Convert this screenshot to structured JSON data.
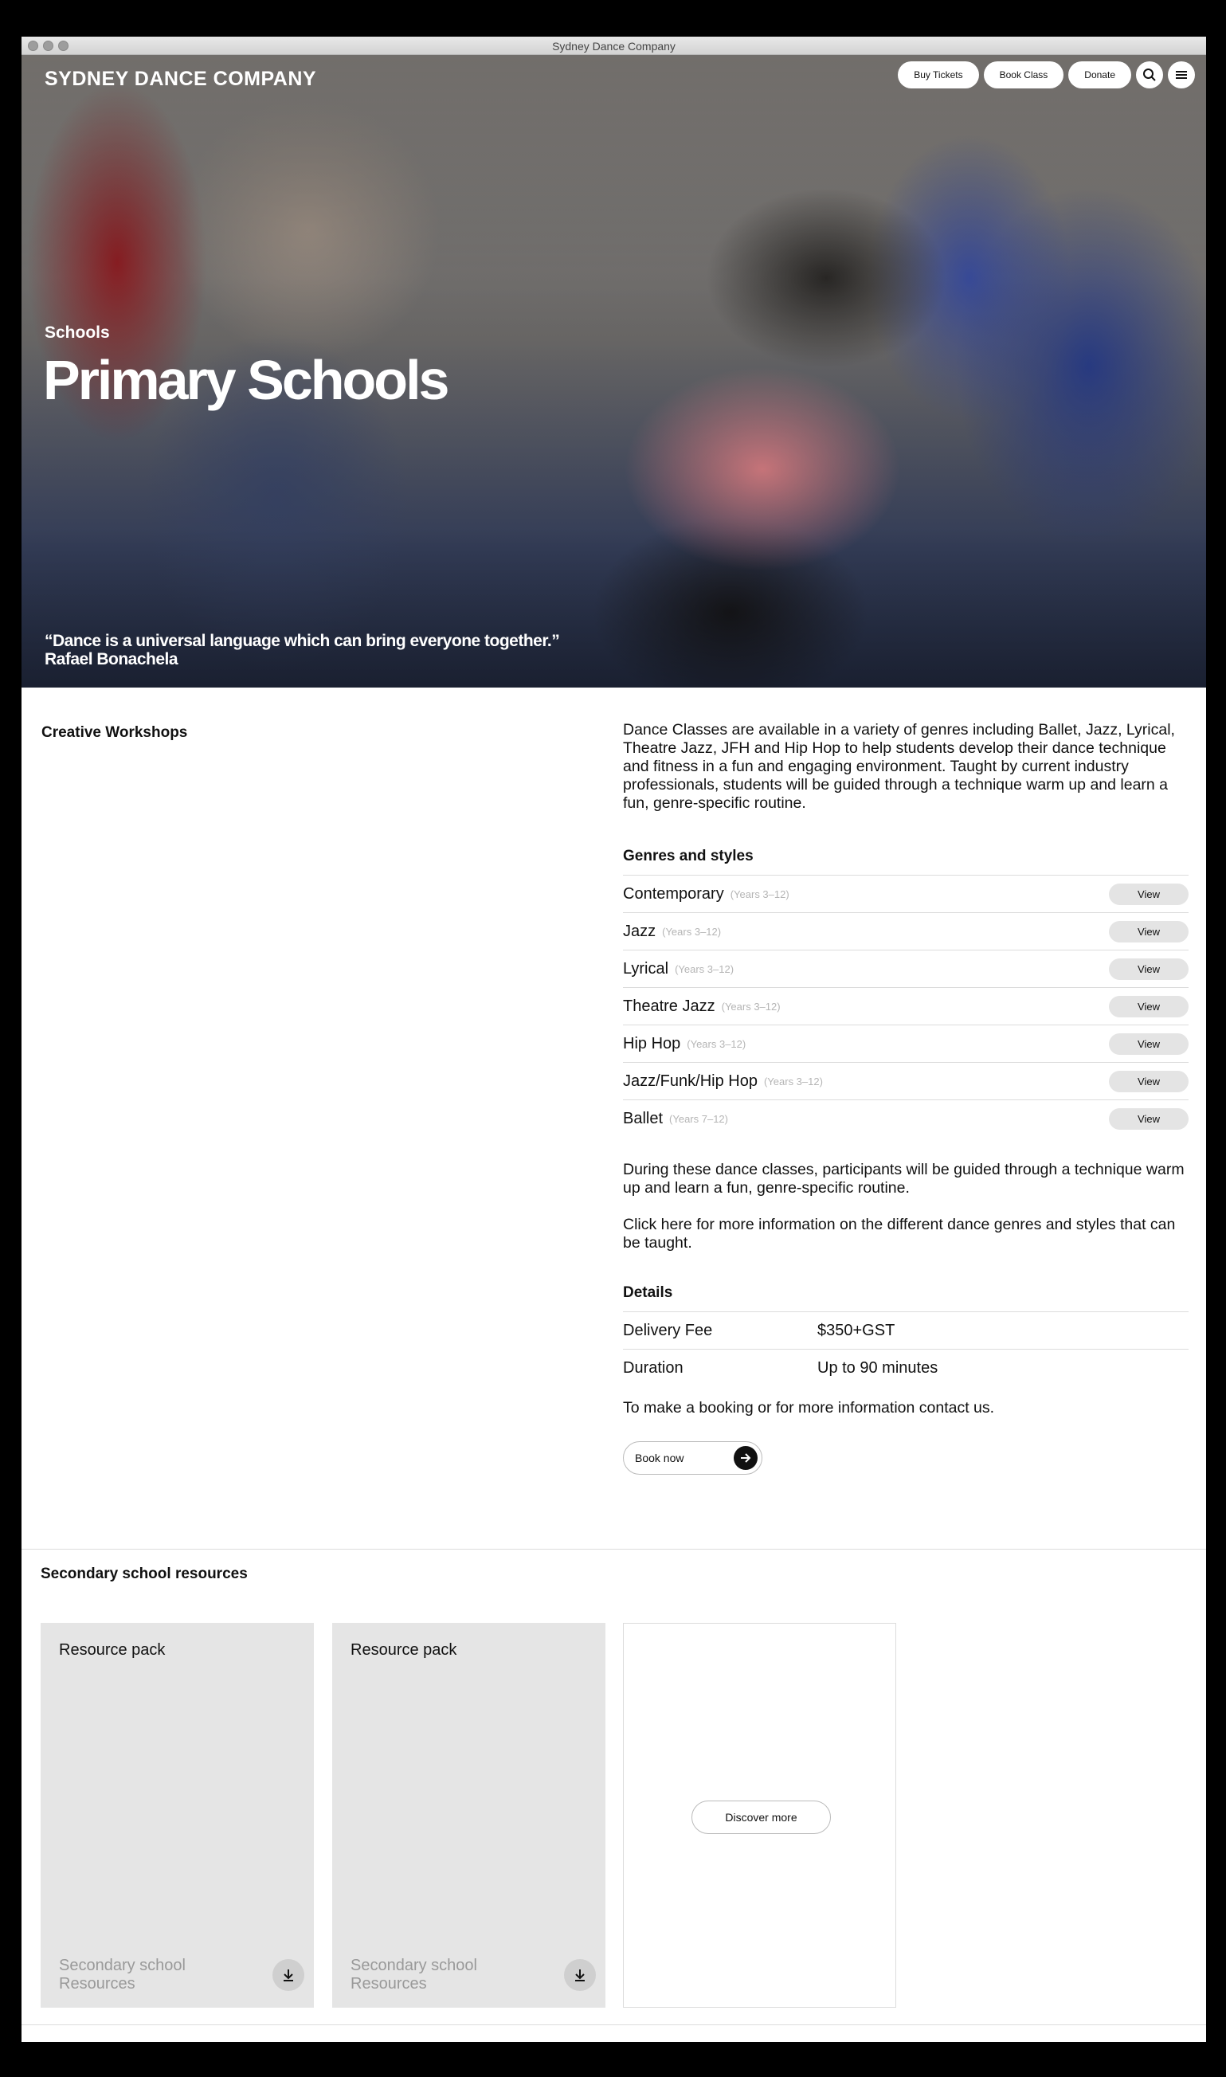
{
  "window": {
    "title": "Sydney Dance Company"
  },
  "header": {
    "logo": "SYDNEY DANCE COMPANY",
    "buy_tickets": "Buy Tickets",
    "book_class": "Book Class",
    "donate": "Donate"
  },
  "hero": {
    "eyebrow": "Schools",
    "title": "Primary Schools",
    "quote": "“Dance is a universal language which can bring everyone together.”",
    "author": "Rafael Bonachela"
  },
  "main": {
    "section_title": "Creative Workshops",
    "intro": "Dance Classes are available in a variety of genres including Ballet, Jazz, Lyrical, Theatre Jazz, JFH and Hip Hop to help students develop their dance technique and fitness in a fun and engaging environment. Taught by current industry professionals, students will be guided through a technique warm up and learn a fun, genre-specific routine.",
    "genres_heading": "Genres and styles",
    "genres": [
      {
        "name": "Contemporary",
        "years": "(Years 3–12)",
        "button": "View"
      },
      {
        "name": "Jazz",
        "years": "(Years 3–12)",
        "button": "View"
      },
      {
        "name": "Lyrical",
        "years": "(Years 3–12)",
        "button": "View"
      },
      {
        "name": "Theatre Jazz",
        "years": "(Years 3–12)",
        "button": "View"
      },
      {
        "name": "Hip Hop",
        "years": "(Years 3–12)",
        "button": "View"
      },
      {
        "name": "Jazz/Funk/Hip Hop",
        "years": "(Years 3–12)",
        "button": "View"
      },
      {
        "name": "Ballet",
        "years": "(Years 7–12)",
        "button": "View"
      }
    ],
    "para2": "During these dance classes, participants will be guided through a technique warm up and learn a fun, genre-specific routine.",
    "para3": "Click here for more information on the different dance genres and styles that can be taught.",
    "details_heading": "Details",
    "details": [
      {
        "label": "Delivery Fee",
        "value": "$350+GST"
      },
      {
        "label": "Duration",
        "value": "Up to 90 minutes"
      }
    ],
    "contact": "To make a booking or for more information contact us.",
    "book_now": "Book now"
  },
  "resources": {
    "heading": "Secondary school resources",
    "cards": [
      {
        "title": "Resource pack",
        "subtitle": "Secondary school Resources"
      },
      {
        "title": "Resource pack",
        "subtitle": "Secondary school Resources"
      }
    ],
    "discover": "Discover more"
  },
  "colors": {
    "accent": "#111111",
    "card_grey": "#e5e5e5",
    "muted": "#999999"
  },
  "icons": [
    "search-icon",
    "menu-icon",
    "arrow-right-icon",
    "download-icon"
  ]
}
